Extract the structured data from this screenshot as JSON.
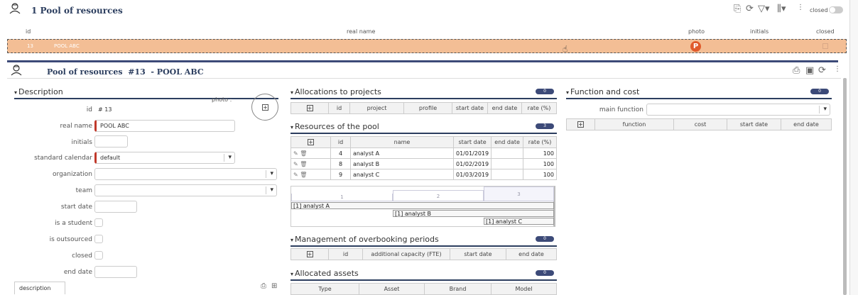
{
  "list": {
    "title": "1 Pool of resources",
    "closed_label": "closed",
    "columns": {
      "id": "id",
      "real_name": "real name",
      "photo": "photo",
      "initials": "initials",
      "closed": "closed"
    },
    "row": {
      "id": "13",
      "name": "POOL ABC",
      "photo_letter": "P"
    }
  },
  "detail": {
    "title": "Pool of resources  #13  - POOL ABC"
  },
  "description": {
    "section_title": "Description",
    "photo_label": "photo :",
    "id_label": "id",
    "id_value": "# 13",
    "fields": {
      "real_name_label": "real name",
      "real_name_value": "POOL ABC",
      "initials_label": "initials",
      "calendar_label": "standard calendar",
      "calendar_value": "default",
      "organization_label": "organization",
      "team_label": "team",
      "start_date_label": "start date",
      "is_student_label": "is a student",
      "is_outsourced_label": "is outsourced",
      "closed_label": "closed",
      "end_date_label": "end date"
    },
    "description_tab": "description"
  },
  "allocations": {
    "title": "Allocations to projects",
    "count": "0",
    "columns": [
      "id",
      "project",
      "profile",
      "start date",
      "end date",
      "rate (%)"
    ]
  },
  "resources_pool": {
    "title": "Resources of the pool",
    "count": "3",
    "columns": [
      "id",
      "name",
      "start date",
      "end date",
      "rate (%)"
    ],
    "rows": [
      {
        "id": "4",
        "name": "analyst A",
        "start": "01/01/2019",
        "end": "",
        "rate": "100"
      },
      {
        "id": "8",
        "name": "analyst B",
        "start": "01/02/2019",
        "end": "",
        "rate": "100"
      },
      {
        "id": "9",
        "name": "analyst C",
        "start": "01/03/2019",
        "end": "",
        "rate": "100"
      }
    ],
    "gantt_periods": [
      "1",
      "2",
      "3"
    ],
    "gantt_bars": [
      "[1] analyst A",
      "[1] analyst B",
      "[1] analyst C"
    ]
  },
  "overbooking": {
    "title": "Management of overbooking periods",
    "count": "0",
    "columns": [
      "id",
      "additional capacity (FTE)",
      "start date",
      "end date"
    ]
  },
  "assets": {
    "title": "Allocated assets",
    "count": "0",
    "columns": [
      "Type",
      "Asset",
      "Brand",
      "Model"
    ]
  },
  "function_cost": {
    "title": "Function and cost",
    "count": "0",
    "main_function_label": "main function",
    "columns": [
      "function",
      "cost",
      "start date",
      "end date"
    ]
  }
}
